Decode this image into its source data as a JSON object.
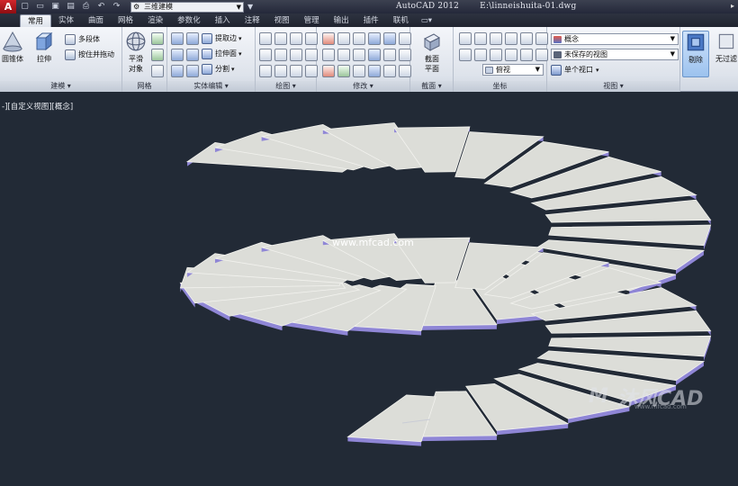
{
  "titlebar": {
    "app_logo": "A",
    "workspace": "三维建模",
    "app_name": "AutoCAD 2012",
    "file_path": "E:\\linneishuita-01.dwg",
    "right_arrow": "▸",
    "quick_access": [
      {
        "name": "new-icon",
        "glyph": "▢"
      },
      {
        "name": "open-icon",
        "glyph": "▭"
      },
      {
        "name": "save-icon",
        "glyph": "▣"
      },
      {
        "name": "saveas-icon",
        "glyph": "▤"
      },
      {
        "name": "print-icon",
        "glyph": "⎙"
      },
      {
        "name": "undo-icon",
        "glyph": "↶"
      },
      {
        "name": "redo-icon",
        "glyph": "↷"
      }
    ]
  },
  "tabs": [
    "常用",
    "实体",
    "曲面",
    "网格",
    "渲染",
    "参数化",
    "插入",
    "注释",
    "视图",
    "管理",
    "输出",
    "插件",
    "联机"
  ],
  "active_tab": "常用",
  "ribbon": {
    "modeling": {
      "title": "建模",
      "box_label": "圆锥体",
      "extrude_label": "拉伸",
      "polysolid_label": "多段体",
      "presspull_label": "按住并拖动"
    },
    "mesh": {
      "title": "网格",
      "smooth_label_1": "平滑",
      "smooth_label_2": "对象"
    },
    "solid_editing": {
      "title": "实体编辑",
      "extract_edges_label": "提取边",
      "extrude_faces_label": "拉伸面",
      "separate_label": "分割"
    },
    "draw": {
      "title": "绘图"
    },
    "modify": {
      "title": "修改"
    },
    "section": {
      "title": "截面",
      "section_plane_label_1": "截面",
      "section_plane_label_2": "平面"
    },
    "coordinates": {
      "title": "坐标",
      "view_select": "俯视"
    },
    "view": {
      "title": "视图",
      "visual_style": "概念",
      "saved_view": "未保存的视图",
      "viewport_config": "单个视口"
    },
    "selection": {
      "cull_label": "剔除",
      "no_filter_label": "无过滤"
    }
  },
  "viewport": {
    "label": "-][自定义视图][概念]",
    "watermark_url": "www.mfcad.com",
    "watermark_brand": "沐风CAD",
    "watermark_sub": "www.mfcad.com"
  },
  "colors": {
    "viewport_bg": "#222a36",
    "step_top": "#dcddd8",
    "step_side": "#8f86d6",
    "step_edge": "#f2f2ee"
  },
  "scene": {
    "description_free": true,
    "turns": 2
  }
}
